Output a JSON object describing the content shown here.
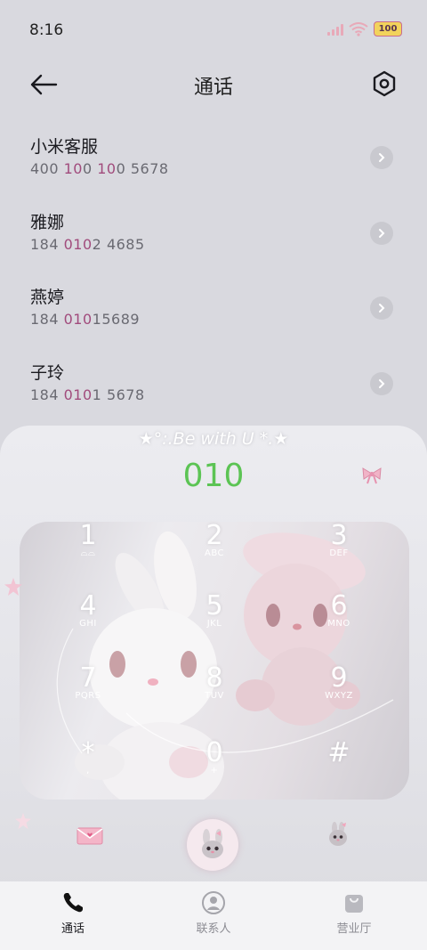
{
  "status_bar": {
    "time": "8:16",
    "battery": "100"
  },
  "header": {
    "title": "通话"
  },
  "contacts": [
    {
      "name": "小米客服",
      "number_parts": [
        "400 ",
        "10",
        "0 ",
        "10",
        "0 5678"
      ]
    },
    {
      "name": "雅娜",
      "number_parts": [
        "184 ",
        "010",
        "2 4685"
      ]
    },
    {
      "name": "燕婷",
      "number_parts": [
        "184 ",
        "010",
        "15689"
      ]
    },
    {
      "name": "子玲",
      "number_parts": [
        "184 ",
        "010",
        "1 5678"
      ]
    }
  ],
  "dialer": {
    "motto": "★°:.Be with U *.★",
    "dialed_number": "010",
    "keys": [
      {
        "digit": "1",
        "letters": "⌓⌓"
      },
      {
        "digit": "2",
        "letters": "ABC"
      },
      {
        "digit": "3",
        "letters": "DEF"
      },
      {
        "digit": "4",
        "letters": "GHI"
      },
      {
        "digit": "5",
        "letters": "JKL"
      },
      {
        "digit": "6",
        "letters": "MNO"
      },
      {
        "digit": "7",
        "letters": "PQRS"
      },
      {
        "digit": "8",
        "letters": "TUV"
      },
      {
        "digit": "9",
        "letters": "WXYZ"
      },
      {
        "digit": "*",
        "letters": ","
      },
      {
        "digit": "0",
        "letters": "+"
      },
      {
        "digit": "#",
        "letters": ""
      }
    ]
  },
  "bottom_nav": {
    "items": [
      {
        "label": "通话",
        "icon": "phone-icon",
        "active": true
      },
      {
        "label": "联系人",
        "icon": "person-icon",
        "active": false
      },
      {
        "label": "营业厅",
        "icon": "bag-icon",
        "active": false
      }
    ]
  },
  "colors": {
    "dialed": "#5cc454",
    "highlight": "#a14b7c",
    "background": "#d9d9df"
  }
}
